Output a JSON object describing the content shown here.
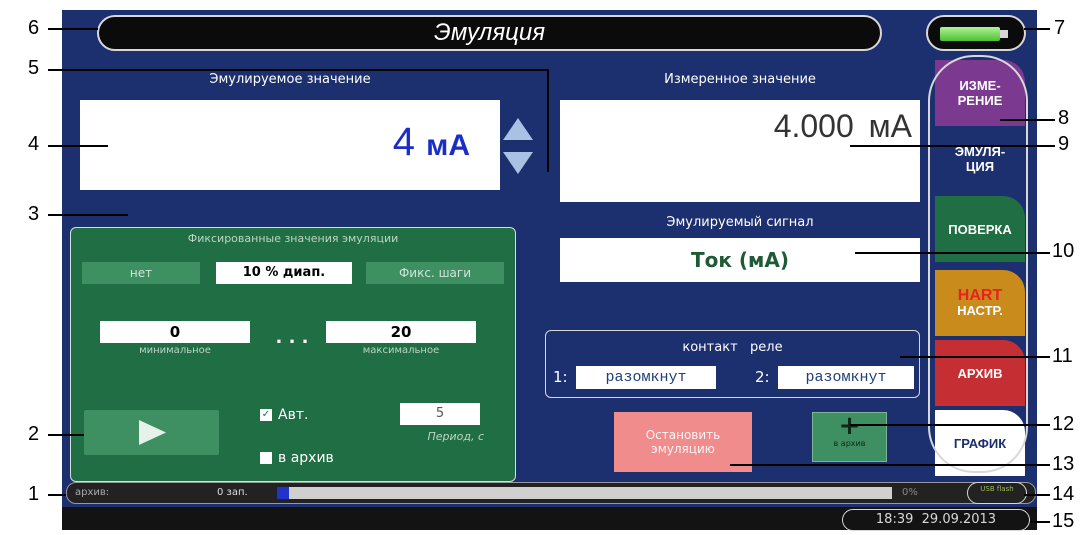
{
  "header": {
    "title": "Эмуляция"
  },
  "emulated": {
    "heading": "Эмулируемое значение",
    "value": "4",
    "unit": "мА"
  },
  "measured": {
    "heading": "Измеренное значение",
    "value": "4.000",
    "unit": "мА"
  },
  "signal": {
    "heading": "Эмулируемый сигнал",
    "value": "Ток (мА)"
  },
  "fixed": {
    "heading": "Фиксированные значения эмуляции",
    "options": [
      "нет",
      "10 % диап.",
      "Фикс. шаги"
    ],
    "min_value": "0",
    "min_label": "минимальное",
    "dots": ". . .",
    "max_value": "20",
    "max_label": "максимальное",
    "auto_label": "Авт.",
    "archive_label": "в архив",
    "period_value": "5",
    "period_label": "Период, с"
  },
  "relay": {
    "heading": "контакт   реле",
    "r1_label": "1:",
    "r1_state": "разомкнут",
    "r2_label": "2:",
    "r2_state": "разомкнут"
  },
  "actions": {
    "stop_label": "Остановить эмуляцию",
    "add_label": "в архив"
  },
  "tabs": [
    {
      "label": "ИЗМЕ-\nРЕНИЕ",
      "color": "#7b3a8f"
    },
    {
      "label": "ЭМУЛЯ-\nЦИЯ",
      "color": "#1c2f6f"
    },
    {
      "label": "ПОВЕРКА",
      "color": "#1f6e44"
    },
    {
      "label": "НАСТР.",
      "sub": "HART",
      "color": "#c98b1b"
    },
    {
      "label": "АРХИВ",
      "color": "#c52f33"
    },
    {
      "label": "ГРАФИК",
      "color": "#ffffff"
    }
  ],
  "status": {
    "archive_label": "архив:",
    "archive_count": "0 зап.",
    "percent": "0%",
    "usb_label": "USB flash",
    "progress_fraction": 0.02
  },
  "clock": {
    "time": "18:39",
    "date": "29.09.2013"
  },
  "callouts": [
    "1",
    "2",
    "3",
    "4",
    "5",
    "6",
    "7",
    "8",
    "9",
    "10",
    "11",
    "12",
    "13",
    "14",
    "15"
  ],
  "colors": {
    "screen_bg": "#1c2f6f",
    "panel_green": "#1f6e44",
    "value_blue": "#1a2ec7",
    "stop_btn": "#f08c8c"
  }
}
